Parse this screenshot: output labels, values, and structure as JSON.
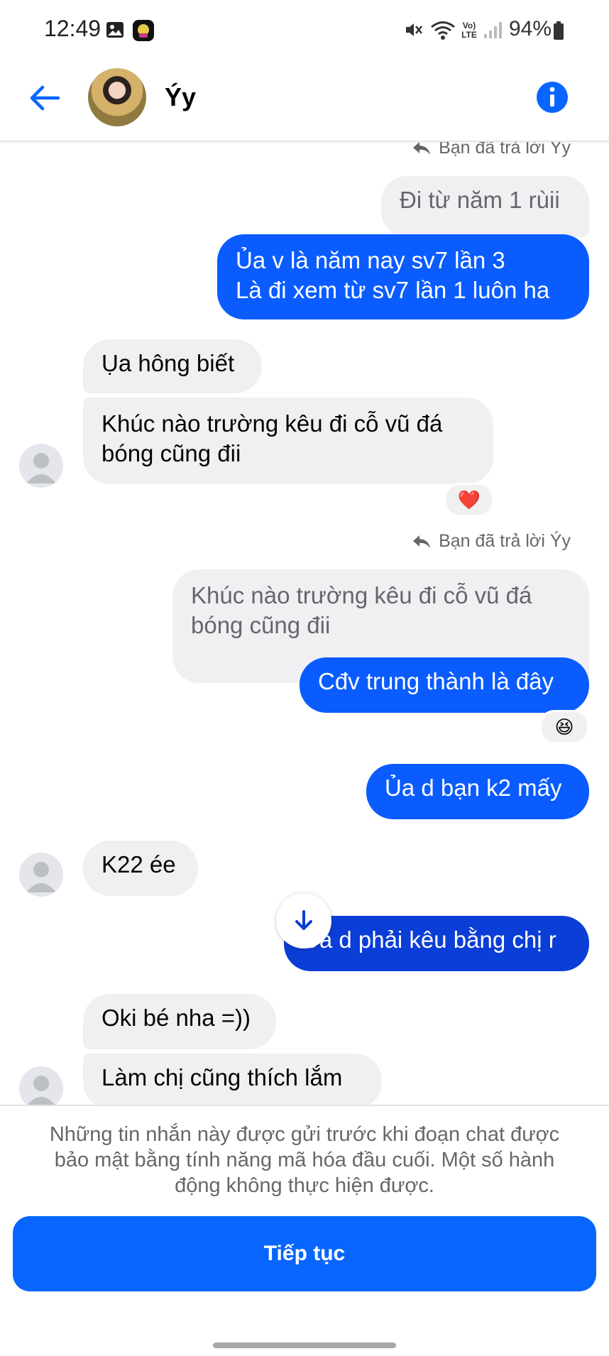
{
  "status_bar": {
    "time": "12:49",
    "volte": "Vo) LTE",
    "battery": "94%",
    "icons": [
      "gallery-icon",
      "app-icon",
      "mute-icon",
      "wifi-icon",
      "signal-icon",
      "battery-icon"
    ]
  },
  "header": {
    "contact_name": "Ýy",
    "back_icon": "back-arrow-icon",
    "info_icon": "info-icon"
  },
  "colors": {
    "accent": "#0866ff",
    "outgoing_bubble": "#0a5cff",
    "outgoing_bubble_dark": "#0b3ed6",
    "incoming_bubble": "#f0f0f0"
  },
  "messages": {
    "reply_label_1": "Bạn đã trả lời Ýy",
    "quoted_1": "Đi từ năm 1 rùii",
    "out_1": "Ủa v là năm nay sv7 lần 3\nLà đi xem từ sv7 lần 1 luôn ha",
    "in_1": "Ụa hông biết",
    "in_2": "Khúc nào trường kêu đi cỗ vũ đá\nbóng cũng đii",
    "reaction_1": "❤️",
    "reply_label_2": "Bạn đã trả lời Ýy",
    "quoted_2": "Khúc nào trường kêu đi cỗ vũ đá\nbóng cũng đii",
    "out_2": "Cđv trung thành là đây",
    "reaction_2": "😆",
    "out_3": "Ủa d bạn k2 mấy",
    "in_3": "K22 ée",
    "out_4": "Ủa d phải kêu bằng chị r",
    "in_4": "Oki bé nha =))",
    "in_5": "Làm chị cũng thích lắm"
  },
  "bottom": {
    "notice": "Những tin nhắn này được gửi trước khi đoạn chat được bảo mật bằng tính năng mã hóa đầu cuối. Một số hành động không thực hiện được.",
    "continue_label": "Tiếp tục"
  }
}
